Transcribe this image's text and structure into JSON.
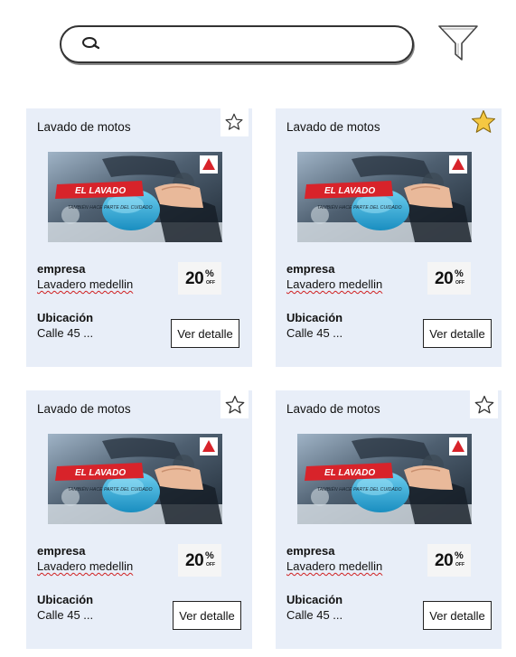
{
  "search": {
    "placeholder": "",
    "icon": "search-icon"
  },
  "filter": {
    "icon": "filter-icon"
  },
  "colors": {
    "card_bg": "#e8eef8",
    "star_fav": "#f5c842"
  },
  "cards": [
    {
      "title": "Lavado de motos",
      "favorite": false,
      "image": {
        "banner": "EL LAVADO",
        "tagline": "TAMBIÉN HACE PARTE DEL CUIDADO"
      },
      "company_label": "empresa",
      "company_value": "Lavadero medellin",
      "discount": {
        "number": "20",
        "percent": "%",
        "off": "OFF"
      },
      "location_label": "Ubicación",
      "location_value": "Calle 45 ...",
      "button_label": "Ver detalle"
    },
    {
      "title": "Lavado de motos",
      "favorite": true,
      "image": {
        "banner": "EL LAVADO",
        "tagline": "TAMBIÉN HACE PARTE DEL CUIDADO"
      },
      "company_label": "empresa",
      "company_value": "Lavadero medellin",
      "discount": {
        "number": "20",
        "percent": "%",
        "off": "OFF"
      },
      "location_label": "Ubicación",
      "location_value": "Calle 45 ...",
      "button_label": "Ver detalle"
    },
    {
      "title": "Lavado de motos",
      "favorite": false,
      "image": {
        "banner": "EL LAVADO",
        "tagline": "TAMBIÉN HACE PARTE DEL CUIDADO"
      },
      "company_label": "empresa",
      "company_value": "Lavadero medellin",
      "discount": {
        "number": "20",
        "percent": "%",
        "off": "OFF"
      },
      "location_label": "Ubicación",
      "location_value": "Calle 45 ...",
      "button_label": "Ver detalle"
    },
    {
      "title": "Lavado de motos",
      "favorite": false,
      "image": {
        "banner": "EL LAVADO",
        "tagline": "TAMBIÉN HACE PARTE DEL CUIDADO"
      },
      "company_label": "empresa",
      "company_value": "Lavadero medellin",
      "discount": {
        "number": "20",
        "percent": "%",
        "off": "OFF"
      },
      "location_label": "Ubicación",
      "location_value": "Calle 45 ...",
      "button_label": "Ver detalle"
    }
  ]
}
